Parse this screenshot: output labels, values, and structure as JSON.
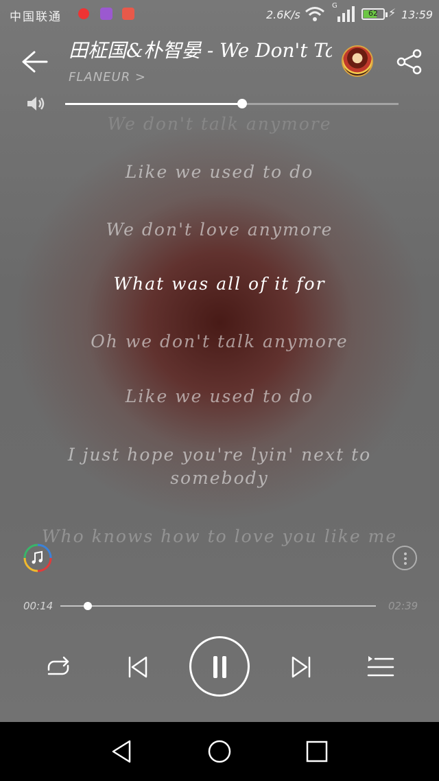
{
  "status_bar": {
    "carrier": "中国联通",
    "net_speed": "2.6K/s",
    "network_type": "G",
    "battery": "62",
    "time": "13:59"
  },
  "header": {
    "title": "田柾国&朴智晏 - We Don't Talk Anymore",
    "artist": "FLANEUR >"
  },
  "volume": {
    "level": 0.53
  },
  "lyrics": [
    {
      "text": "We don't talk anymore",
      "state": "faded"
    },
    {
      "text": "Like we used to do",
      "state": "normal"
    },
    {
      "text": "We don't love anymore",
      "state": "normal"
    },
    {
      "text": "What was all of it for",
      "state": "current"
    },
    {
      "text": "Oh we don't talk anymore",
      "state": "normal"
    },
    {
      "text": "Like we used to do",
      "state": "normal"
    },
    {
      "text": "I just hope you're lyin' next to somebody",
      "state": "normal"
    },
    {
      "text": "Who knows how to love you like me",
      "state": "dim"
    }
  ],
  "playback": {
    "current_time": "00:14",
    "total_time": "02:39",
    "progress": 0.088,
    "state": "playing"
  },
  "icons": {
    "back": "arrow-left-icon",
    "share": "share-icon",
    "volume": "speaker-icon",
    "repeat": "repeat-icon",
    "previous": "skip-previous-icon",
    "pause": "pause-icon",
    "next": "skip-next-icon",
    "playlist": "playlist-icon",
    "more": "more-vertical-icon"
  },
  "colors": {
    "accent": "#ffffff",
    "battery": "#6cc644"
  }
}
